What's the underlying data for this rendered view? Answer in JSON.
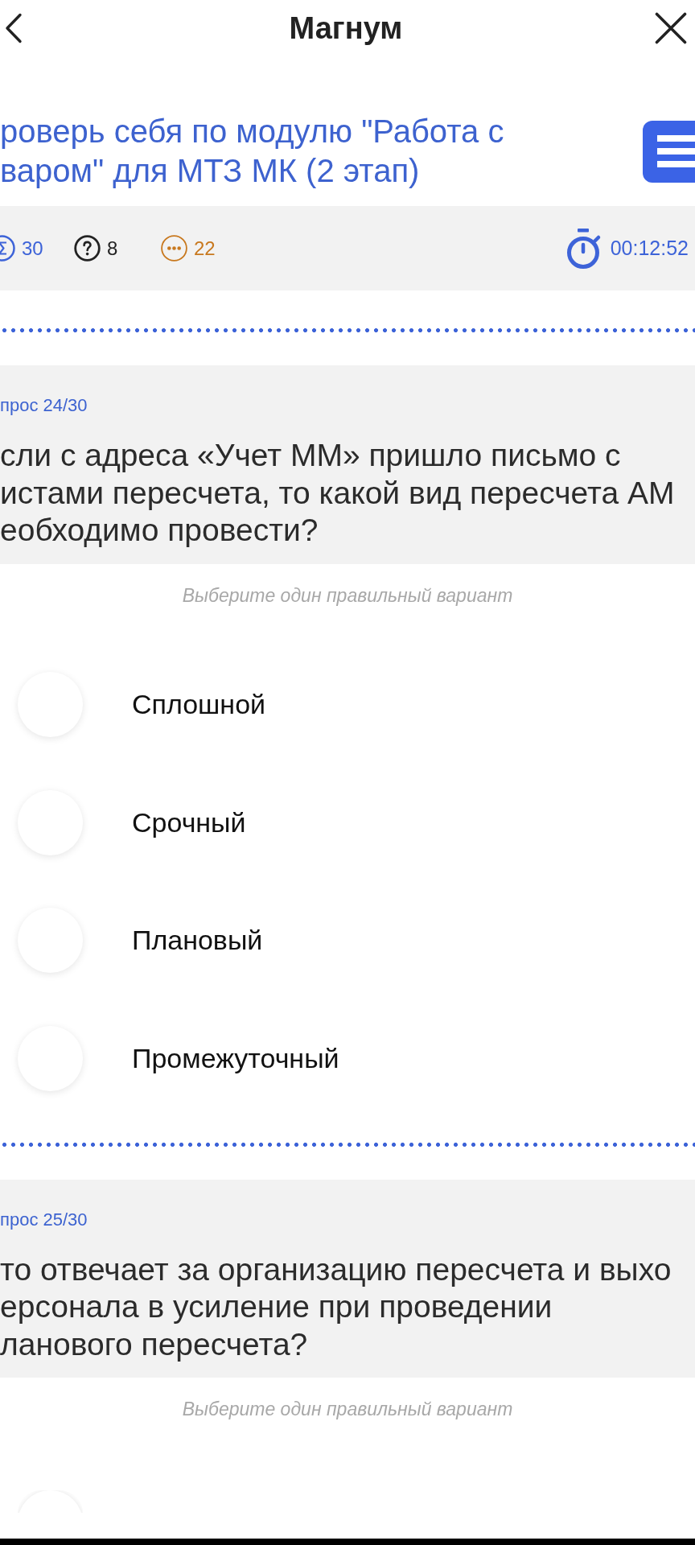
{
  "header": {
    "title": "Магнум"
  },
  "test": {
    "title": "роверь себя по модулю \"Работа с\nваром\" для МТЗ МК (2 этап)"
  },
  "stats": [
    {
      "kind": "sigma",
      "value": "30",
      "color": "#3d63d8"
    },
    {
      "kind": "question",
      "value": "8",
      "color": "#222222"
    },
    {
      "kind": "ellipsis",
      "value": "22",
      "color": "#c8781e"
    }
  ],
  "timer": {
    "time": "00:12:52"
  },
  "questions": [
    {
      "number": "прос 24/30",
      "text": "сли с адреса «Учет ММ» пришло письмо с\nистами пересчета, то какой вид пересчета АМ\nеобходимо провести?",
      "hint": "Выберите один правильный вариант",
      "options": [
        {
          "label": "Сплошной",
          "selected": false
        },
        {
          "label": "Срочный",
          "selected": false
        },
        {
          "label": "Плановый",
          "selected": false
        },
        {
          "label": "Промежуточный",
          "selected": false
        }
      ]
    },
    {
      "number": "прос 25/30",
      "text": "то отвечает за организацию пересчета и выхо\nерсонала в усиление при проведении\nланового пересчета?",
      "hint": "Выберите один правильный вариант",
      "options": [
        {
          "selected": false
        }
      ]
    }
  ]
}
